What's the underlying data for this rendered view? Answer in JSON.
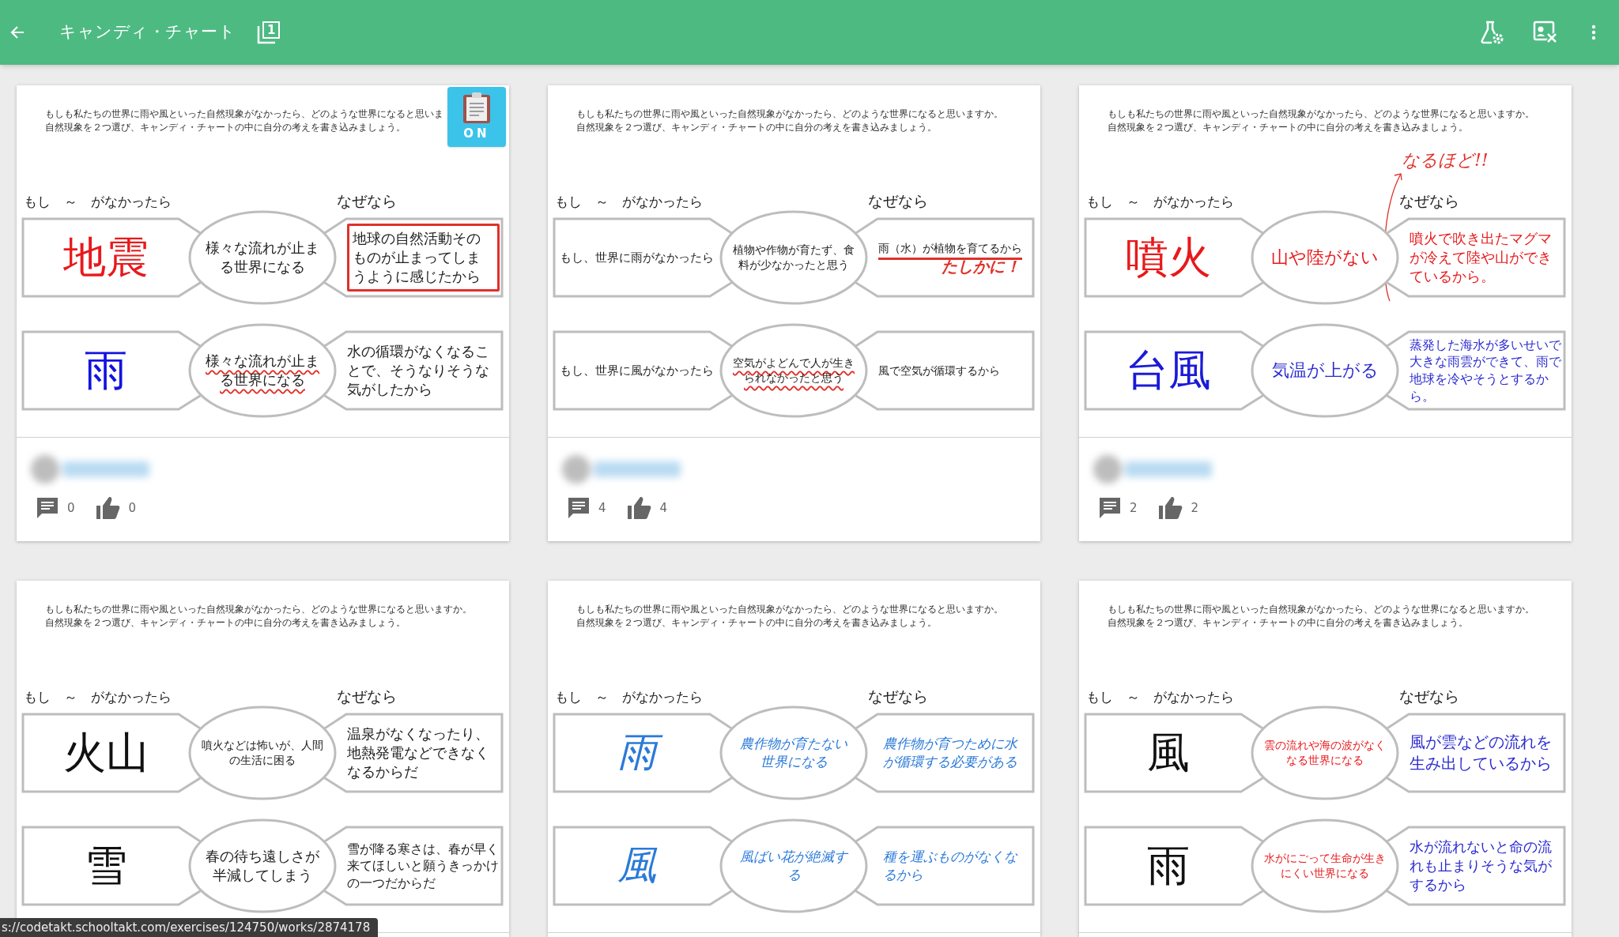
{
  "app_bar": {
    "title": "キャンディ・チャート",
    "page_count": "1"
  },
  "cards": [
    {
      "kind": "typed",
      "prompt": [
        "もしも私たちの世界に雨や風といった自然現象がなかったら、どのような世界になると思いま",
        "自然現象を２つ選び、キャンディ・チャートの中に自分の考えを書き込みましょう。"
      ],
      "badge": {
        "label": "ON"
      },
      "header": {
        "left": "もし　～　がなかったら",
        "right": "なぜなら"
      },
      "rows": [
        {
          "subject": {
            "text": "地震",
            "color": "#e8191b"
          },
          "effect": {
            "text": "様々な流れが止まる世界になる",
            "color": "#222222",
            "kind": "plain"
          },
          "reason": {
            "text": "地球の自然活動そのものが止まってしまうように感じたから",
            "color": "#222222",
            "kind": "boxed"
          }
        },
        {
          "subject": {
            "text": "雨",
            "color": "#1212e0"
          },
          "effect": {
            "text": "様々な流れが止まる世界になる",
            "color": "#222222",
            "kind": "wavy"
          },
          "reason": {
            "text": "水の循環がなくなることで、そうなりそうな気がしたから",
            "color": "#222222",
            "kind": "plain"
          }
        }
      ],
      "footer": {
        "comments": "0",
        "likes": "0"
      }
    },
    {
      "kind": "typed",
      "prompt": [
        "もしも私たちの世界に雨や風といった自然現象がなかったら、どのような世界になると思いますか。",
        "自然現象を２つ選び、キャンディ・チャートの中に自分の考えを書き込みましょう。"
      ],
      "header": {
        "left": "もし　～　がなかったら",
        "right": "なぜなら"
      },
      "rows": [
        {
          "subject": {
            "text": "もし、世界に雨がなかったら",
            "color": "#222222"
          },
          "effect": {
            "text": "植物や作物が育たず、食料が少なかったと思う",
            "color": "#222222",
            "kind": "plain"
          },
          "reason": {
            "text": "雨（水）が植物を育てるから",
            "color": "#222222",
            "kind": "underlined",
            "comment": "たしかに！"
          }
        },
        {
          "subject": {
            "text": "もし、世界に風がなかったら",
            "color": "#222222"
          },
          "effect": {
            "text": "空気がよどんで人が生きられなかったと思う",
            "color": "#222222",
            "kind": "wavy"
          },
          "reason": {
            "text": "風で空気が循環するから",
            "color": "#222222",
            "kind": "plain"
          }
        }
      ],
      "footer": {
        "comments": "4",
        "likes": "4"
      }
    },
    {
      "kind": "typed",
      "prompt": [
        "もしも私たちの世界に雨や風といった自然現象がなかったら、どのような世界になると思いますか。",
        "自然現象を２つ選び、キャンディ・チャートの中に自分の考えを書き込みましょう。"
      ],
      "header": {
        "left": "もし　～　がなかったら",
        "right": "なぜなら"
      },
      "comment": "なるほど!!",
      "rows": [
        {
          "subject": {
            "text": "噴火",
            "color": "#e8191b"
          },
          "effect": {
            "text": "山や陸がない",
            "color": "#e8191b",
            "kind": "plain"
          },
          "reason": {
            "text": "噴火で吹き出たマグマが冷えて陸や山ができているから。",
            "color": "#e8191b",
            "kind": "plain"
          }
        },
        {
          "subject": {
            "text": "台風",
            "color": "#1a1ad8"
          },
          "effect": {
            "text": "気温が上がる",
            "color": "#2b2bd0",
            "kind": "plain"
          },
          "reason": {
            "text": "蒸発した海水が多いせいで大きな雨雲ができて、雨で地球を冷やそうとするから。",
            "color": "#2b2bd0",
            "kind": "plain"
          }
        }
      ],
      "footer": {
        "comments": "2",
        "likes": "2"
      }
    },
    {
      "kind": "typed",
      "prompt": [
        "もしも私たちの世界に雨や風といった自然現象がなかったら、どのような世界になると思いますか。",
        "自然現象を２つ選び、キャンディ・チャートの中に自分の考えを書き込みましょう。"
      ],
      "header": {
        "left": "もし　～　がなかったら",
        "right": "なぜなら"
      },
      "rows": [
        {
          "subject": {
            "text": "火山",
            "color": "#111111"
          },
          "effect": {
            "text": "噴火などは怖いが、人間の生活に困る",
            "color": "#222222",
            "kind": "plain"
          },
          "reason": {
            "text": "温泉がなくなったり、地熱発電などできなくなるからだ",
            "color": "#222222",
            "kind": "plain"
          }
        },
        {
          "subject": {
            "text": "雪",
            "color": "#111111"
          },
          "effect": {
            "text": "春の待ち遠しさが半減してしまう",
            "color": "#222222",
            "kind": "plain"
          },
          "reason": {
            "text": "雪が降る寒さは、春が早く来てほしいと願うきっかけの一つだからだ",
            "color": "#222222",
            "kind": "plain"
          }
        }
      ]
    },
    {
      "kind": "handwritten",
      "prompt": [
        "もしも私たちの世界に雨や風といった自然現象がなかったら、どのような世界になると思いますか。",
        "自然現象を２つ選び、キャンディ・チャートの中に自分の考えを書き込みましょう。"
      ],
      "header": {
        "left": "もし　～　がなかったら",
        "right": "なぜなら"
      },
      "rows": [
        {
          "subject": {
            "text": "雨",
            "color": "#2a7ad8"
          },
          "effect": {
            "text": "農作物が育たない世界になる",
            "color": "#2a7ad8",
            "kind": "plain"
          },
          "reason": {
            "text": "農作物が育つために水が循環する必要がある",
            "color": "#2a7ad8",
            "kind": "plain"
          }
        },
        {
          "subject": {
            "text": "風",
            "color": "#2a7ad8"
          },
          "effect": {
            "text": "風ばい花が絶滅する",
            "color": "#2a7ad8",
            "kind": "plain"
          },
          "reason": {
            "text": "種を運ぶものがなくなるから",
            "color": "#2a7ad8",
            "kind": "plain"
          }
        }
      ]
    },
    {
      "kind": "typed",
      "prompt": [
        "もしも私たちの世界に雨や風といった自然現象がなかったら、どのような世界になると思いますか。",
        "自然現象を２つ選び、キャンディ・チャートの中に自分の考えを書き込みましょう。"
      ],
      "header": {
        "left": "もし　～　がなかったら",
        "right": "なぜなら"
      },
      "rows": [
        {
          "subject": {
            "text": "風",
            "color": "#111111"
          },
          "effect": {
            "text": "雲の流れや海の波がなくなる世界になる",
            "color": "#e8191b",
            "kind": "plain"
          },
          "reason": {
            "text": "風が雲などの流れを生み出しているから",
            "color": "#2b2bd0",
            "kind": "plain"
          }
        },
        {
          "subject": {
            "text": "雨",
            "color": "#111111"
          },
          "effect": {
            "text": "水がにごって生命が生きにくい世界になる",
            "color": "#e8191b",
            "kind": "plain"
          },
          "reason": {
            "text": "水が流れないと命の流れも止まりそうな気がするから",
            "color": "#2b2bd0",
            "kind": "plain"
          }
        }
      ]
    }
  ],
  "status_url": "s://codetakt.schooltakt.com/exercises/124750/works/2874178"
}
